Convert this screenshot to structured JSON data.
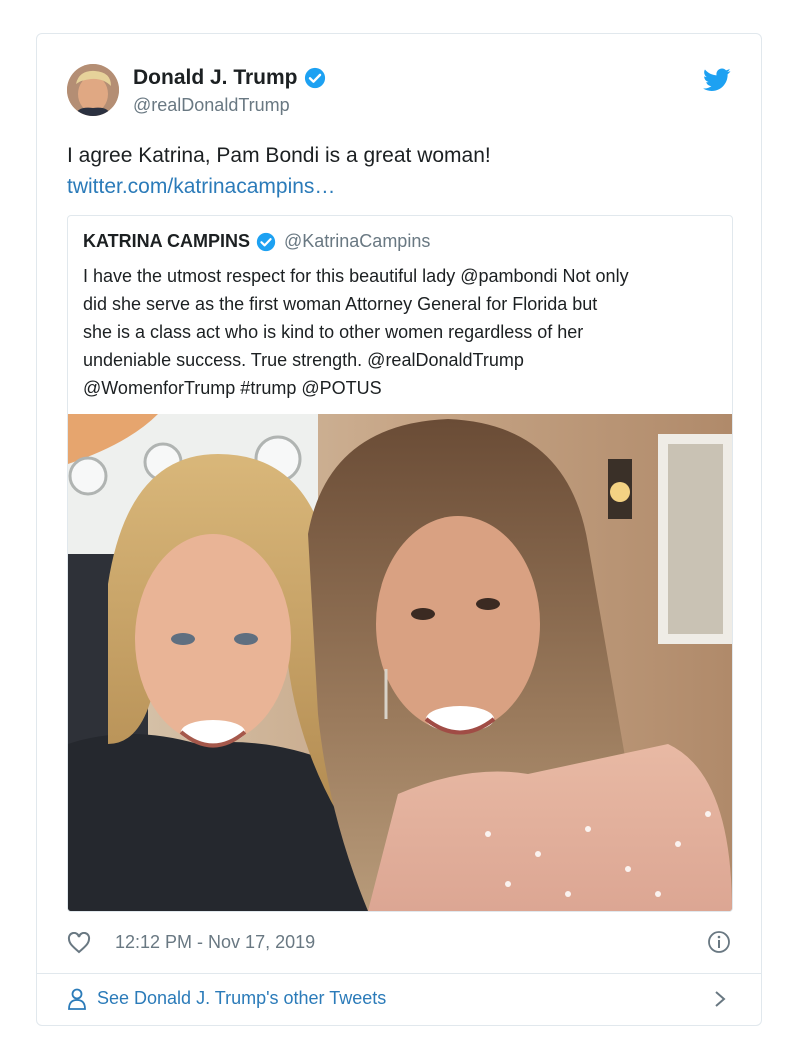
{
  "tweet": {
    "author_name": "Donald J. Trump",
    "author_handle": "@realDonaldTrump",
    "text": "I agree Katrina, Pam Bondi is a great woman!",
    "link_text": "twitter.com/katrinacampins…",
    "timestamp": "12:12 PM - Nov 17, 2019"
  },
  "quoted": {
    "author_name": "KATRINA CAMPINS",
    "author_handle": "@KatrinaCampins",
    "lines": [
      "I have the utmost respect for this beautiful lady @pambondi Not only",
      "did she serve as the first woman Attorney General for Florida but",
      "she is a class act who is kind to other women regardless of her",
      "undeniable success. True strength. @realDonaldTrump",
      "@WomenforTrump #trump @POTUS"
    ]
  },
  "footer": {
    "label": "See Donald J. Trump's other Tweets"
  },
  "icons": {
    "verified": "verified-badge-icon",
    "bird": "twitter-bird-icon",
    "heart": "heart-icon",
    "info": "info-icon",
    "person": "person-icon",
    "chevron": "chevron-right-icon"
  },
  "colors": {
    "accent": "#1da1f2",
    "link": "#2b7bb9",
    "secondary_text": "#697882",
    "border": "#e1e8ed"
  }
}
